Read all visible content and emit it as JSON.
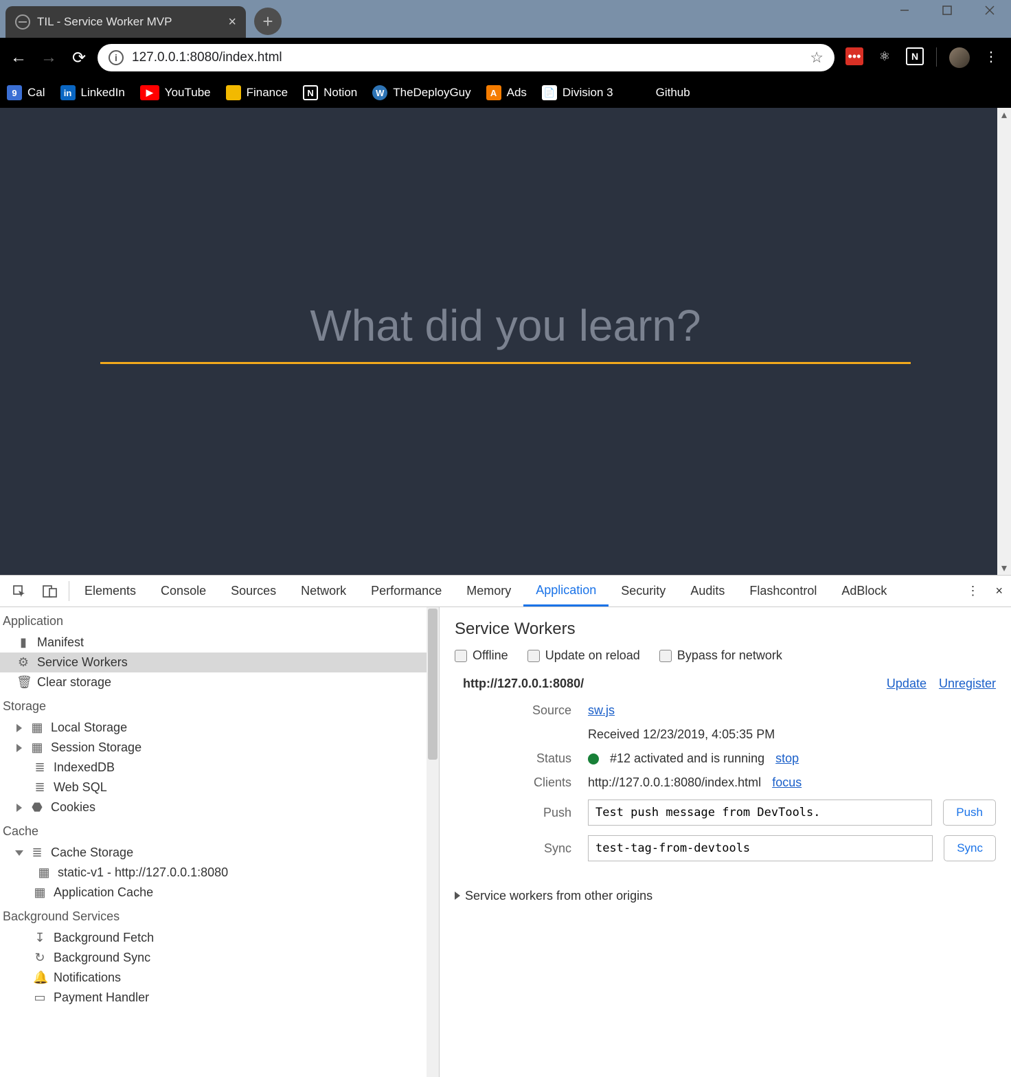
{
  "window": {
    "tab_title": "TIL - Service Worker MVP",
    "url": "127.0.0.1:8080/index.html"
  },
  "bookmarks": [
    {
      "label": "Cal",
      "icon": "cal",
      "text": "9"
    },
    {
      "label": "LinkedIn",
      "icon": "li",
      "text": "in"
    },
    {
      "label": "YouTube",
      "icon": "yt",
      "text": "▶"
    },
    {
      "label": "Finance",
      "icon": "fin",
      "text": ""
    },
    {
      "label": "Notion",
      "icon": "no",
      "text": "N"
    },
    {
      "label": "TheDeployGuy",
      "icon": "wp",
      "text": "W"
    },
    {
      "label": "Ads",
      "icon": "ads",
      "text": "A"
    },
    {
      "label": "Division 3",
      "icon": "div",
      "text": "📄"
    },
    {
      "label": "Github",
      "icon": "",
      "text": ""
    }
  ],
  "page": {
    "hero_placeholder": "What did you learn?"
  },
  "devtools": {
    "panels": [
      "Elements",
      "Console",
      "Sources",
      "Network",
      "Performance",
      "Memory",
      "Application",
      "Security",
      "Audits",
      "Flashcontrol",
      "AdBlock"
    ],
    "active_panel": "Application",
    "sidebar": {
      "application": {
        "label": "Application",
        "items": [
          "Manifest",
          "Service Workers",
          "Clear storage"
        ],
        "selected": "Service Workers"
      },
      "storage": {
        "label": "Storage",
        "items": [
          "Local Storage",
          "Session Storage",
          "IndexedDB",
          "Web SQL",
          "Cookies"
        ]
      },
      "cache": {
        "label": "Cache",
        "items": [
          "Cache Storage",
          "Application Cache"
        ],
        "sub": "static-v1 - http://127.0.0.1:8080"
      },
      "bg": {
        "label": "Background Services",
        "items": [
          "Background Fetch",
          "Background Sync",
          "Notifications",
          "Payment Handler"
        ]
      }
    },
    "sw": {
      "title": "Service Workers",
      "checks": [
        "Offline",
        "Update on reload",
        "Bypass for network"
      ],
      "origin": "http://127.0.0.1:8080/",
      "update": "Update",
      "unregister": "Unregister",
      "source_label": "Source",
      "source_link": "sw.js",
      "received": "Received 12/23/2019, 4:05:35 PM",
      "status_label": "Status",
      "status_text": "#12 activated and is running",
      "status_stop": "stop",
      "clients_label": "Clients",
      "clients_val": "http://127.0.0.1:8080/index.html",
      "clients_focus": "focus",
      "push_label": "Push",
      "push_val": "Test push message from DevTools.",
      "push_btn": "Push",
      "sync_label": "Sync",
      "sync_val": "test-tag-from-devtools",
      "sync_btn": "Sync",
      "other": "Service workers from other origins"
    }
  }
}
